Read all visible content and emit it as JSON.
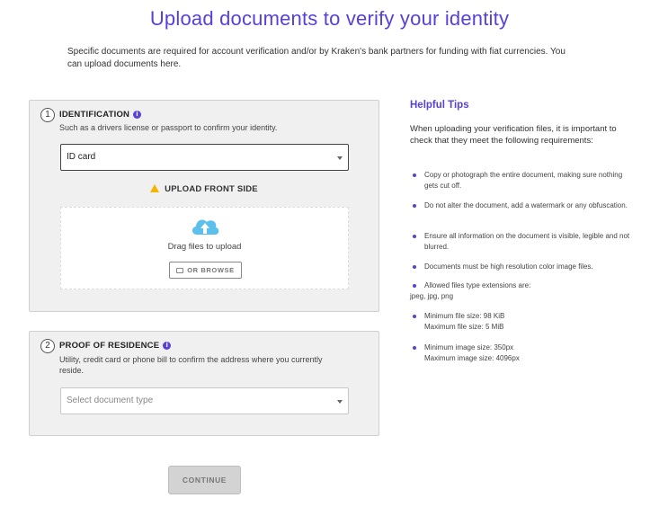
{
  "page": {
    "title": "Upload documents to verify your identity",
    "intro": "Specific documents are required for account verification and/or by Kraken's bank partners for funding with fiat currencies. You can upload documents here."
  },
  "identification": {
    "step": "1",
    "title": "IDENTIFICATION",
    "description": "Such as a drivers license or passport to confirm your identity.",
    "selected_value": "ID card",
    "upload_label": "UPLOAD FRONT SIDE",
    "drag_text": "Drag files to upload",
    "browse_label": "OR BROWSE"
  },
  "residence": {
    "step": "2",
    "title": "PROOF OF RESIDENCE",
    "description": "Utility, credit card or phone bill to confirm the address where you currently reside.",
    "placeholder": "Select document type"
  },
  "tips": {
    "title": "Helpful Tips",
    "intro": "When uploading your verification files, it is important to check that they meet the following requirements:",
    "items": [
      "Copy or photograph the entire document, making sure nothing gets cut off.",
      "Do not alter the document, add a watermark or any obfuscation.",
      "Ensure all information on the document is visible, legible and not blurred.",
      "Documents must be high resolution color image files.",
      "Allowed files type extensions are:",
      "jpeg, jpg, png",
      "Minimum file size: 98 KiB",
      "Maximum file size: 5 MiB",
      "Minimum image size: 350px",
      "Maximum image size: 4096px"
    ]
  },
  "continue_label": "CONTINUE",
  "colors": {
    "accent": "#5741d9",
    "warning": "#f5b400",
    "cloud": "#5bc0eb"
  },
  "icons": [
    "info-icon",
    "warning-icon",
    "cloud-upload-icon",
    "folder-icon",
    "chevron-down-icon"
  ]
}
